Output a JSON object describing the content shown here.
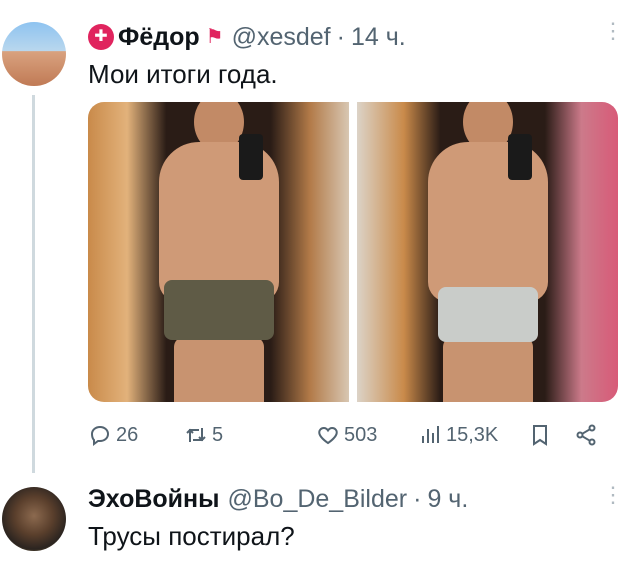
{
  "tweets": [
    {
      "name": "Фёдор",
      "handle": "@xesdef",
      "dot": "·",
      "time": "14 ч.",
      "text": "Мои итоги года.",
      "stats": {
        "replies": "26",
        "retweets": "5",
        "likes": "503",
        "views": "15,3K"
      }
    },
    {
      "name": "ЭхоВойны",
      "handle": "@Bo_De_Bilder",
      "dot": "·",
      "time": "9 ч.",
      "text": "Трусы постирал?"
    }
  ],
  "icons": {
    "badge": "lifebuoy-icon",
    "flag": "red-flag-icon",
    "more": "more-vertical-icon",
    "reply": "reply-icon",
    "retweet": "retweet-icon",
    "like": "heart-icon",
    "views": "views-icon",
    "bookmark": "bookmark-icon",
    "share": "share-icon"
  },
  "colors": {
    "text": "#0f1419",
    "secondary": "#536471",
    "divider": "#cfd9de"
  }
}
